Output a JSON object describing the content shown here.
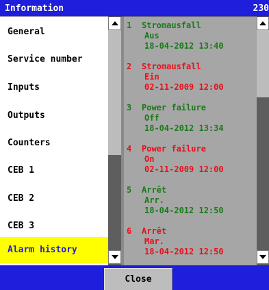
{
  "window": {
    "title": "Information",
    "title_number": "230"
  },
  "menu": {
    "items": [
      {
        "label": "General"
      },
      {
        "label": "Service number"
      },
      {
        "label": "Inputs"
      },
      {
        "label": "Outputs"
      },
      {
        "label": "Counters"
      },
      {
        "label": "CEB 1"
      },
      {
        "label": "CEB 2"
      },
      {
        "label": "CEB 3"
      },
      {
        "label": "Alarm history"
      }
    ],
    "selected_index": 8
  },
  "alarms": [
    {
      "num": "1",
      "title": "Stromausfall",
      "state": "Aus",
      "timestamp": "18-04-2012 13:40",
      "color": "#1a7a1a"
    },
    {
      "num": "2",
      "title": "Stromausfall",
      "state": "Ein",
      "timestamp": "02-11-2009 12:00",
      "color": "#e8101a"
    },
    {
      "num": "3",
      "title": "Power failure",
      "state": "Off",
      "timestamp": "18-04-2012 13:34",
      "color": "#1a7a1a"
    },
    {
      "num": "4",
      "title": "Power failure",
      "state": "On",
      "timestamp": "02-11-2009 12:00",
      "color": "#e8101a"
    },
    {
      "num": "5",
      "title": "Arrêt",
      "state": "Arr.",
      "timestamp": "18-04-2012 12:50",
      "color": "#1a7a1a"
    },
    {
      "num": "6",
      "title": "Arrêt",
      "state": "Mar.",
      "timestamp": "18-04-2012 12:50",
      "color": "#e8101a"
    }
  ],
  "footer": {
    "close_label": "Close"
  },
  "colors": {
    "titlebar": "#1e1edc",
    "selected_bg": "#ffff00",
    "alarm_active": "#e8101a",
    "alarm_cleared": "#1a7a1a"
  }
}
